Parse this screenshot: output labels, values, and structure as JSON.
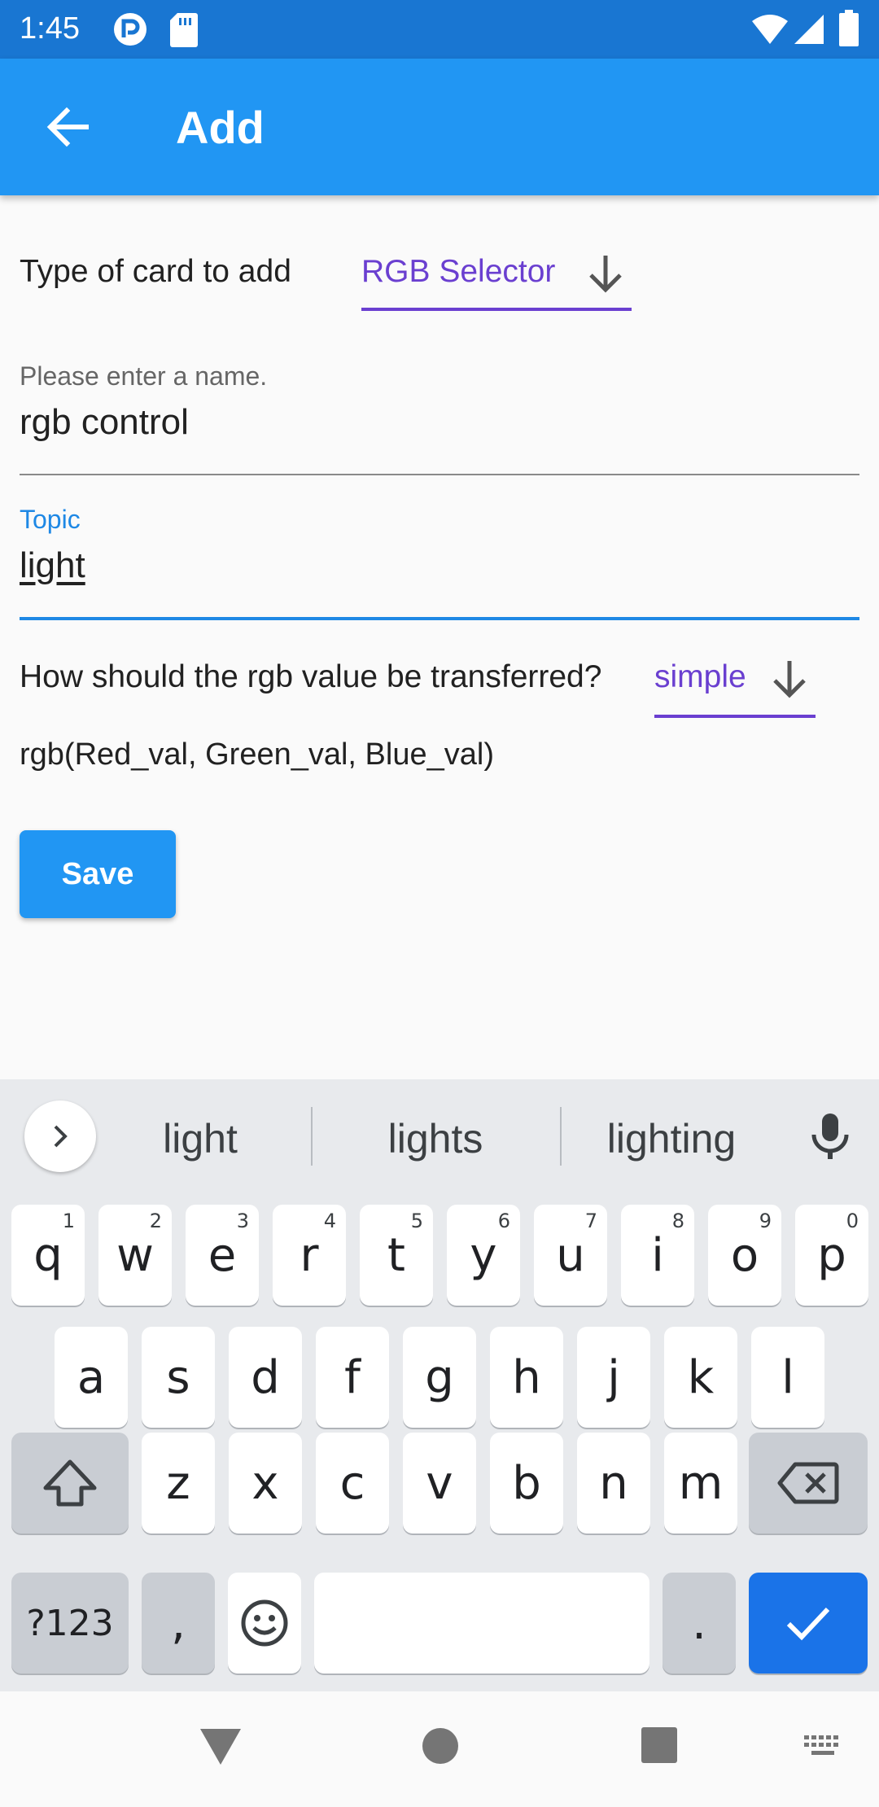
{
  "status_bar": {
    "time": "1:45"
  },
  "app_bar": {
    "title": "Add"
  },
  "form": {
    "card_type_label": "Type of card to add",
    "card_type_value": "RGB Selector",
    "name_label": "Please enter a name.",
    "name_value": "rgb control",
    "topic_label": "Topic",
    "topic_value": "light",
    "transfer_label": "How should the rgb value be transferred?",
    "transfer_value": "simple",
    "rgb_format": "rgb(Red_val, Green_val, Blue_val)",
    "save_label": "Save"
  },
  "keyboard": {
    "suggestions": [
      "light",
      "lights",
      "lighting"
    ],
    "row1": [
      {
        "key": "q",
        "hint": "1"
      },
      {
        "key": "w",
        "hint": "2"
      },
      {
        "key": "e",
        "hint": "3"
      },
      {
        "key": "r",
        "hint": "4"
      },
      {
        "key": "t",
        "hint": "5"
      },
      {
        "key": "y",
        "hint": "6"
      },
      {
        "key": "u",
        "hint": "7"
      },
      {
        "key": "i",
        "hint": "8"
      },
      {
        "key": "o",
        "hint": "9"
      },
      {
        "key": "p",
        "hint": "0"
      }
    ],
    "row2": [
      "a",
      "s",
      "d",
      "f",
      "g",
      "h",
      "j",
      "k",
      "l"
    ],
    "row3": [
      "z",
      "x",
      "c",
      "v",
      "b",
      "n",
      "m"
    ],
    "symbols_label": "?123",
    "comma": ",",
    "period": ".",
    "icons": {
      "shift": "shift-icon",
      "backspace": "backspace-icon",
      "emoji": "emoji-icon",
      "enter": "check-icon",
      "mic": "mic-icon",
      "expand": "chevron-right-icon"
    }
  },
  "colors": {
    "status_bar": "#1976d2",
    "app_bar": "#2196f3",
    "dropdown_accent": "#6a3fd0",
    "focus_accent": "#1e88e5",
    "enter_key": "#1a73e8"
  }
}
